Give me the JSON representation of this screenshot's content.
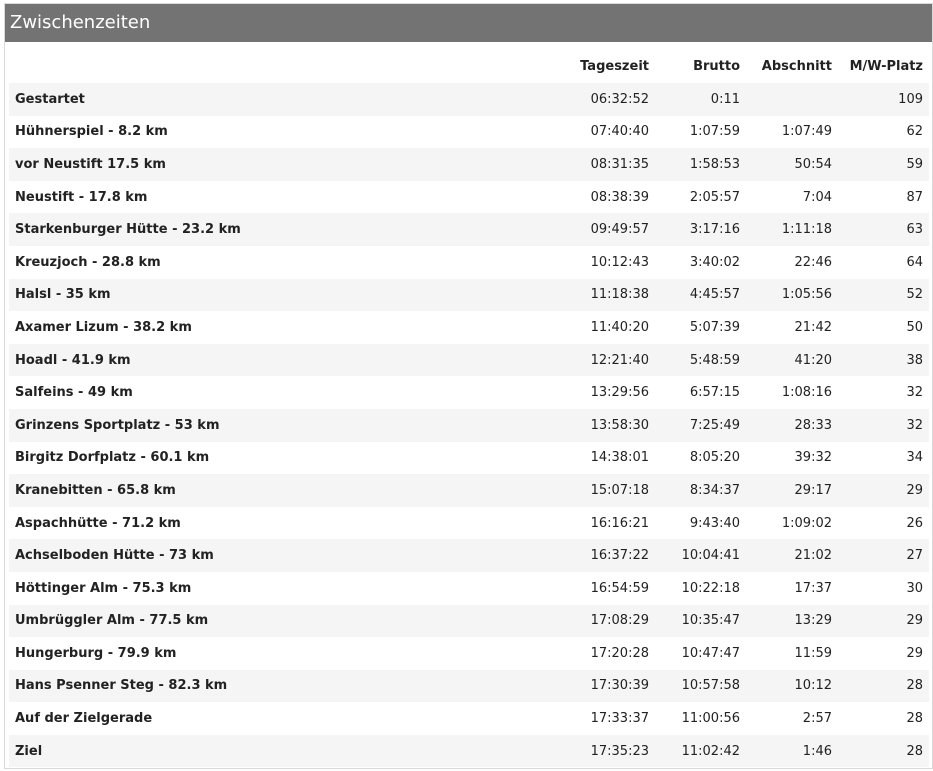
{
  "panel": {
    "title": "Zwischenzeiten"
  },
  "columns": {
    "name": "",
    "tageszeit": "Tageszeit",
    "brutto": "Brutto",
    "abschnitt": "Abschnitt",
    "platz": "M/W-Platz"
  },
  "rows": [
    {
      "name": "Gestartet",
      "tageszeit": "06:32:52",
      "brutto": "0:11",
      "abschnitt": "",
      "platz": "109"
    },
    {
      "name": "Hühnerspiel - 8.2 km",
      "tageszeit": "07:40:40",
      "brutto": "1:07:59",
      "abschnitt": "1:07:49",
      "platz": "62"
    },
    {
      "name": "vor Neustift 17.5 km",
      "tageszeit": "08:31:35",
      "brutto": "1:58:53",
      "abschnitt": "50:54",
      "platz": "59"
    },
    {
      "name": "Neustift - 17.8 km",
      "tageszeit": "08:38:39",
      "brutto": "2:05:57",
      "abschnitt": "7:04",
      "platz": "87"
    },
    {
      "name": "Starkenburger Hütte - 23.2 km",
      "tageszeit": "09:49:57",
      "brutto": "3:17:16",
      "abschnitt": "1:11:18",
      "platz": "63"
    },
    {
      "name": "Kreuzjoch - 28.8 km",
      "tageszeit": "10:12:43",
      "brutto": "3:40:02",
      "abschnitt": "22:46",
      "platz": "64"
    },
    {
      "name": "Halsl - 35 km",
      "tageszeit": "11:18:38",
      "brutto": "4:45:57",
      "abschnitt": "1:05:56",
      "platz": "52"
    },
    {
      "name": "Axamer Lizum - 38.2 km",
      "tageszeit": "11:40:20",
      "brutto": "5:07:39",
      "abschnitt": "21:42",
      "platz": "50"
    },
    {
      "name": "Hoadl - 41.9 km",
      "tageszeit": "12:21:40",
      "brutto": "5:48:59",
      "abschnitt": "41:20",
      "platz": "38"
    },
    {
      "name": "Salfeins - 49 km",
      "tageszeit": "13:29:56",
      "brutto": "6:57:15",
      "abschnitt": "1:08:16",
      "platz": "32"
    },
    {
      "name": "Grinzens Sportplatz - 53 km",
      "tageszeit": "13:58:30",
      "brutto": "7:25:49",
      "abschnitt": "28:33",
      "platz": "32"
    },
    {
      "name": "Birgitz Dorfplatz - 60.1 km",
      "tageszeit": "14:38:01",
      "brutto": "8:05:20",
      "abschnitt": "39:32",
      "platz": "34"
    },
    {
      "name": "Kranebitten - 65.8 km",
      "tageszeit": "15:07:18",
      "brutto": "8:34:37",
      "abschnitt": "29:17",
      "platz": "29"
    },
    {
      "name": "Aspachhütte - 71.2 km",
      "tageszeit": "16:16:21",
      "brutto": "9:43:40",
      "abschnitt": "1:09:02",
      "platz": "26"
    },
    {
      "name": "Achselboden Hütte - 73 km",
      "tageszeit": "16:37:22",
      "brutto": "10:04:41",
      "abschnitt": "21:02",
      "platz": "27"
    },
    {
      "name": "Höttinger Alm - 75.3 km",
      "tageszeit": "16:54:59",
      "brutto": "10:22:18",
      "abschnitt": "17:37",
      "platz": "30"
    },
    {
      "name": "Umbrüggler Alm - 77.5 km",
      "tageszeit": "17:08:29",
      "brutto": "10:35:47",
      "abschnitt": "13:29",
      "platz": "29"
    },
    {
      "name": "Hungerburg - 79.9 km",
      "tageszeit": "17:20:28",
      "brutto": "10:47:47",
      "abschnitt": "11:59",
      "platz": "29"
    },
    {
      "name": "Hans Psenner Steg - 82.3 km",
      "tageszeit": "17:30:39",
      "brutto": "10:57:58",
      "abschnitt": "10:12",
      "platz": "28"
    },
    {
      "name": "Auf der Zielgerade",
      "tageszeit": "17:33:37",
      "brutto": "11:00:56",
      "abschnitt": "2:57",
      "platz": "28"
    },
    {
      "name": "Ziel",
      "tageszeit": "17:35:23",
      "brutto": "11:02:42",
      "abschnitt": "1:46",
      "platz": "28"
    }
  ]
}
